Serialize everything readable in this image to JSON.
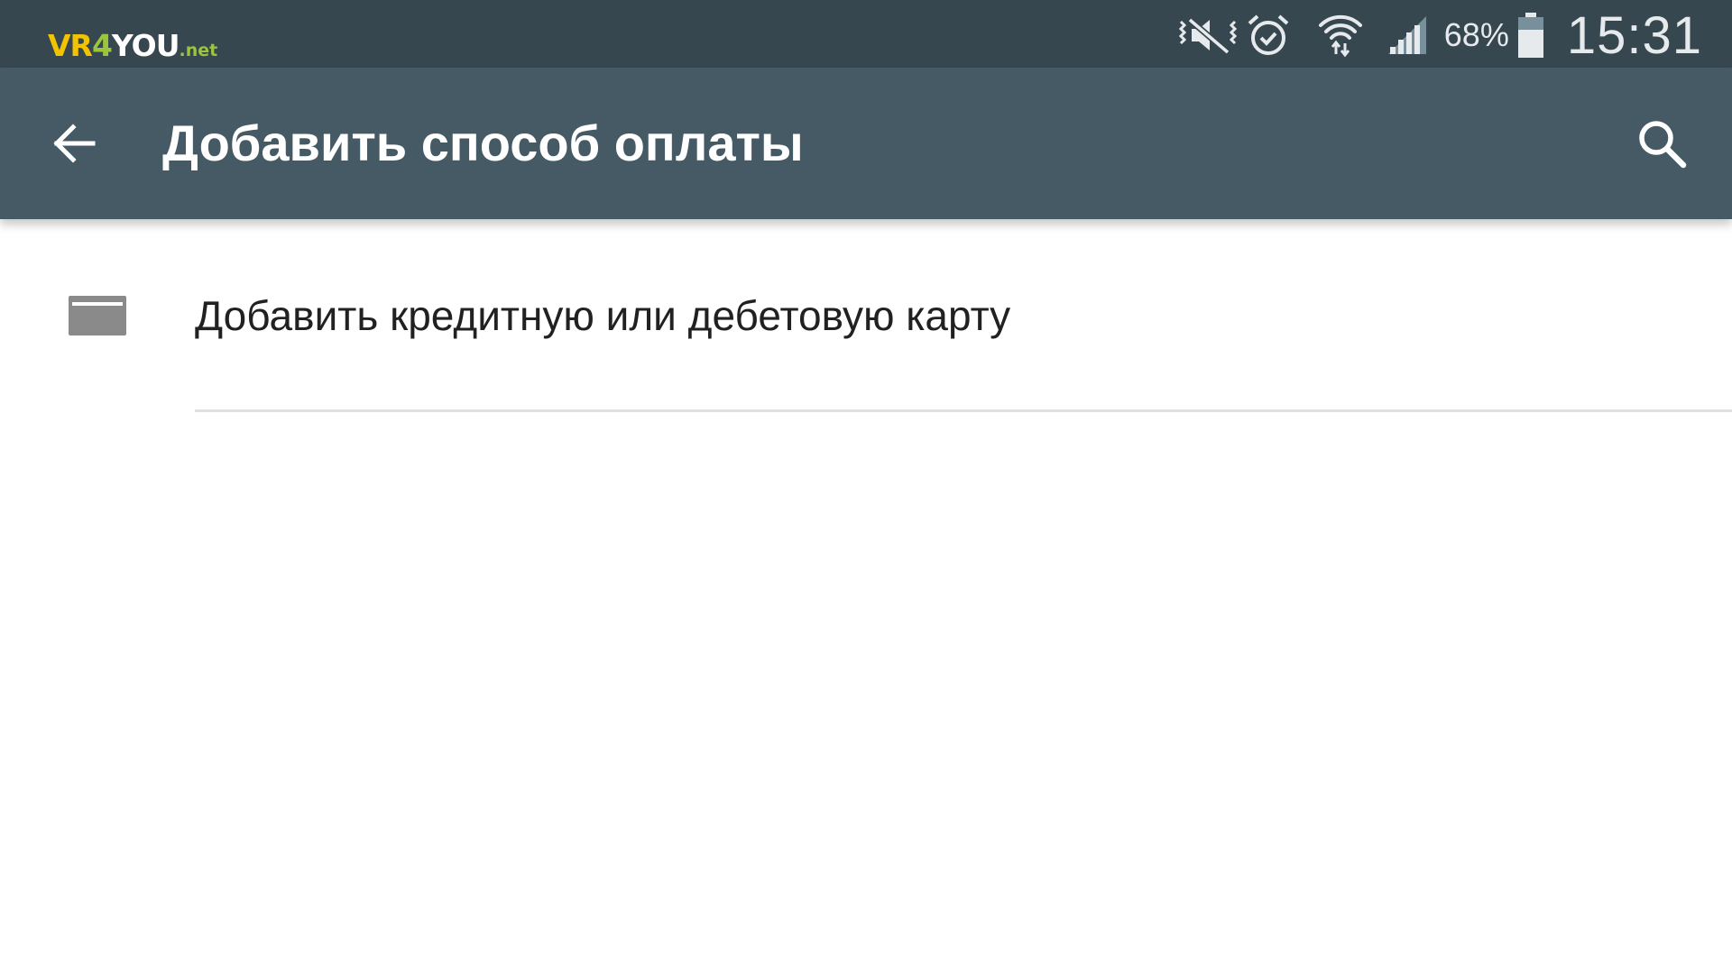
{
  "status_bar": {
    "watermark": {
      "vr": "VR",
      "four": "4",
      "you": "YOU",
      "net": ".net"
    },
    "icons": [
      "mute-vibrate-icon",
      "alarm-icon",
      "wifi-icon",
      "signal-icon",
      "battery-icon"
    ],
    "battery_percent": "68%",
    "battery_level": 0.68,
    "time": "15:31"
  },
  "app_bar": {
    "title": "Добавить способ оплаты",
    "back_icon": "arrow-back-icon",
    "search_icon": "search-icon"
  },
  "payment_options": [
    {
      "icon": "credit-card-icon",
      "label": "Добавить кредитную или дебетовую карту"
    }
  ],
  "colors": {
    "status_bar": "#37474f",
    "app_bar": "#455a64",
    "text_primary": "#212121",
    "icon_gray": "#8a8a8a",
    "divider": "#e0e0e0",
    "watermark_yellow": "#f2c400",
    "watermark_green": "#9bc53d"
  }
}
